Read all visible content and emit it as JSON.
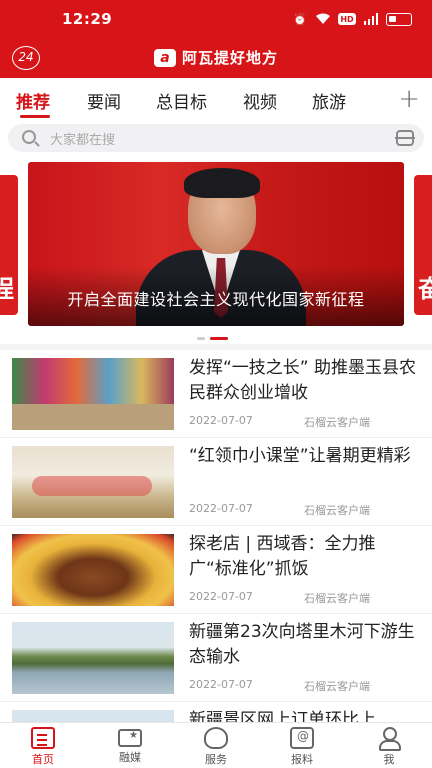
{
  "status_bar": {
    "time": "12:29",
    "icons": [
      "alarm-icon",
      "wifi-icon",
      "hd-icon",
      "signal-icon",
      "battery-icon"
    ],
    "hd_label": "HD"
  },
  "app_bar": {
    "badge": "24",
    "brand_logo": "a",
    "brand_name": "阿瓦提好地方"
  },
  "tabs": {
    "items": [
      "推荐",
      "要闻",
      "总目标",
      "视频",
      "旅游"
    ],
    "active": "推荐",
    "more_icon": "plus-icon"
  },
  "search": {
    "placeholder": "大家都在搜"
  },
  "carousel": {
    "caption": "开启全面建设社会主义现代化国家新征程",
    "left_peek": "程",
    "right_peek": "奋",
    "slide_count": 2,
    "active_index": 1
  },
  "news": [
    {
      "title": "发挥“一技之长” 助推墨玉县农民群众创业增收",
      "date": "2022-07-07",
      "source": "石榴云客户端"
    },
    {
      "title": "“红领巾小课堂”让暑期更精彩",
      "date": "2022-07-07",
      "source": "石榴云客户端"
    },
    {
      "title": "探老店 | 西域香：全力推广“标准化”抓饭",
      "date": "2022-07-07",
      "source": "石榴云客户端"
    },
    {
      "title": "新疆第23次向塔里木河下游生态输水",
      "date": "2022-07-07",
      "source": "石榴云客户端"
    },
    {
      "title": "新疆景区网上订单环比上",
      "date": "",
      "source": ""
    }
  ],
  "bottom_nav": {
    "items": [
      {
        "label": "首页",
        "icon": "home-news-icon"
      },
      {
        "label": "融媒",
        "icon": "media-icon"
      },
      {
        "label": "服务",
        "icon": "service-icon"
      },
      {
        "label": "报料",
        "icon": "report-icon"
      },
      {
        "label": "我",
        "icon": "user-icon"
      }
    ],
    "active": "首页"
  },
  "colors": {
    "brand_red": "#d71418"
  }
}
